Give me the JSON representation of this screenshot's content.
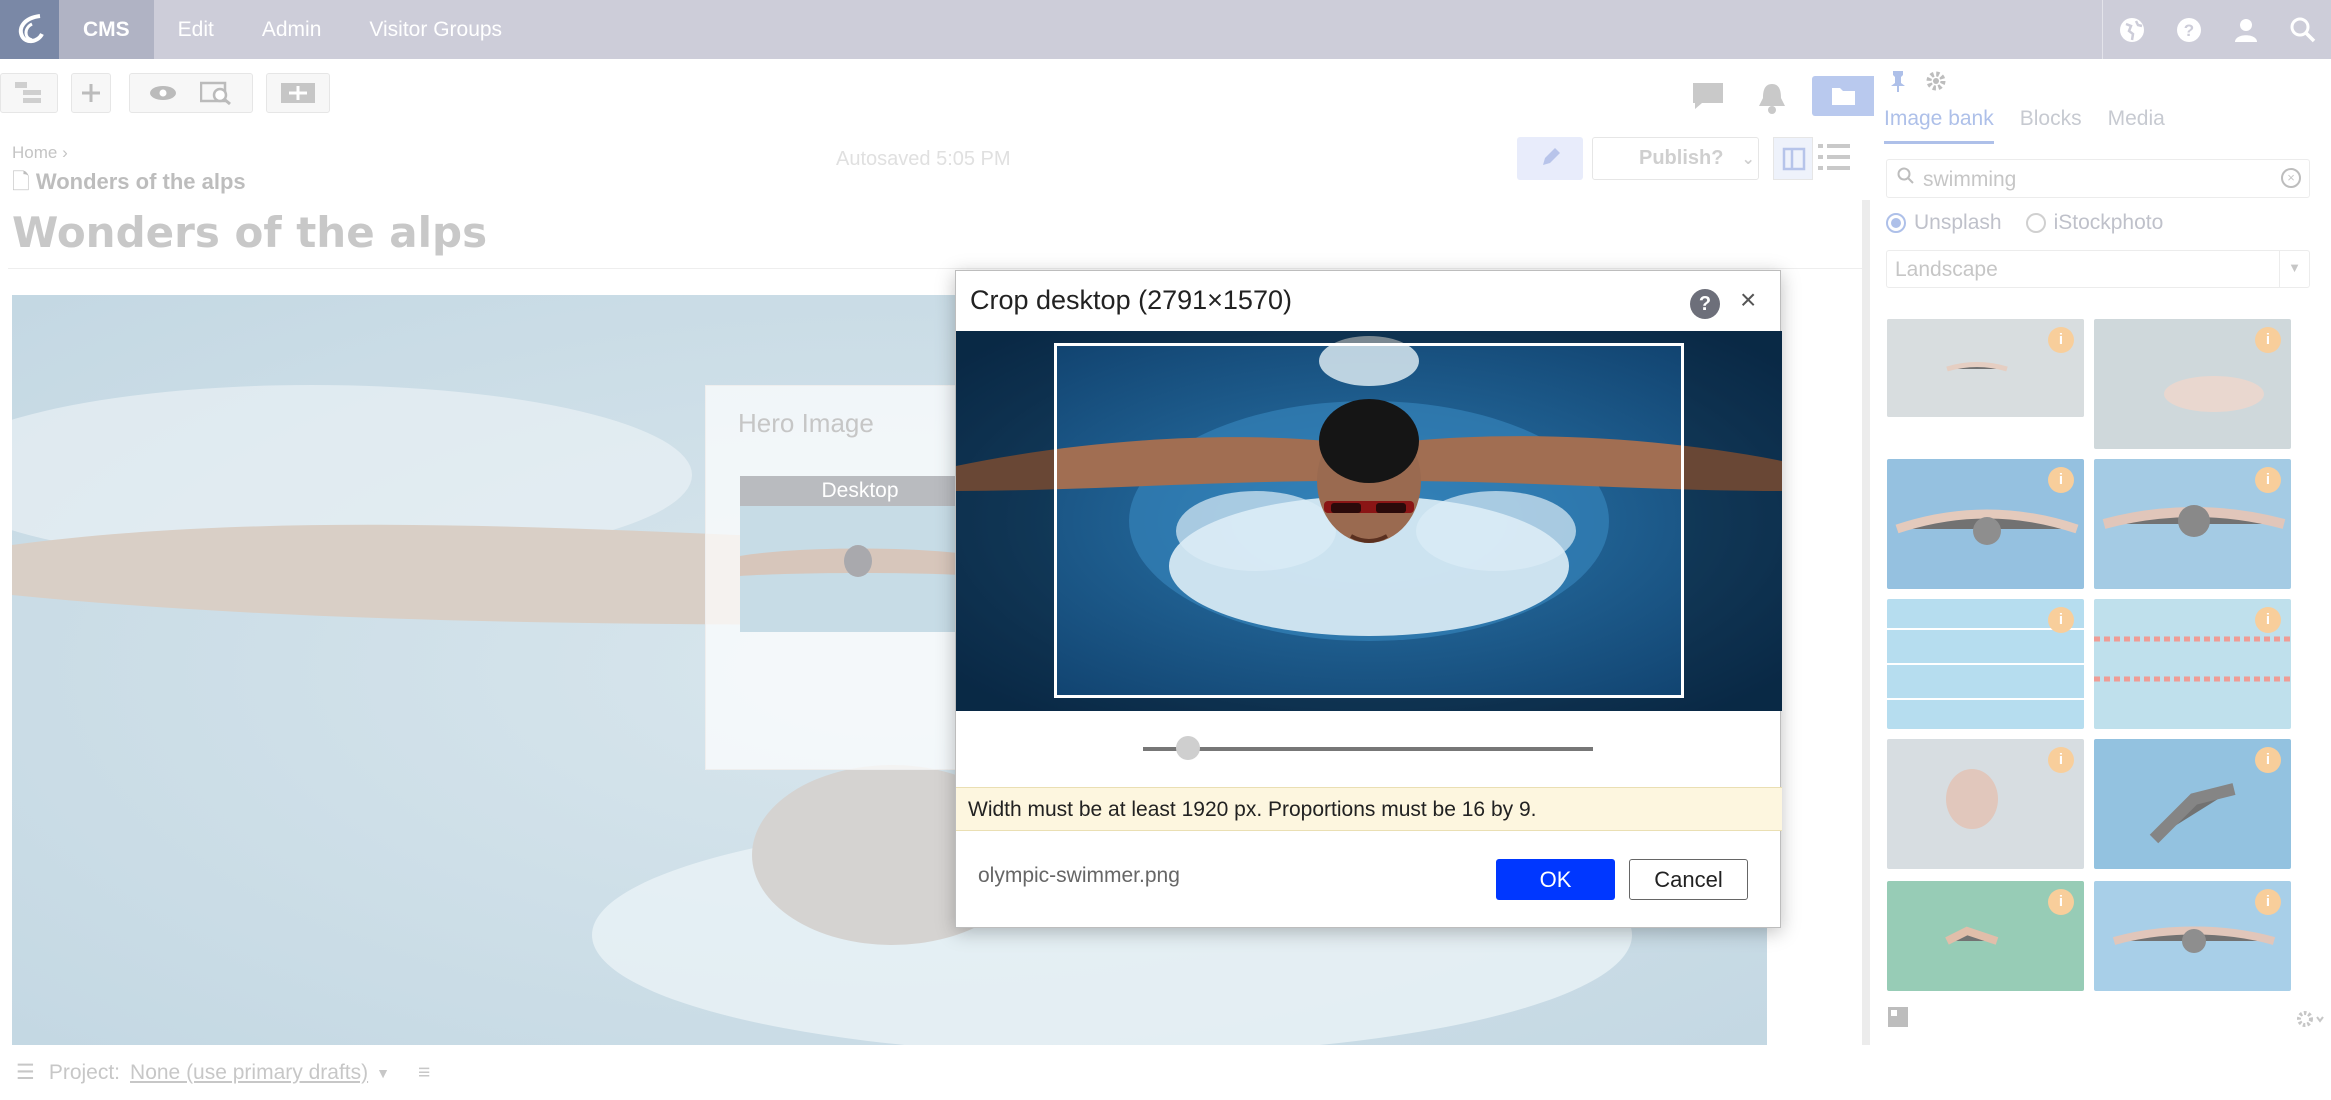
{
  "nav": {
    "items": [
      "CMS",
      "Edit",
      "Admin",
      "Visitor Groups"
    ]
  },
  "toolbar": {
    "autosaved": "Autosaved 5:05 PM",
    "publish": "Publish?"
  },
  "breadcrumb": {
    "home": "Home",
    "page": "Wonders of the alps"
  },
  "page": {
    "title": "Wonders of the alps"
  },
  "hero_panel": {
    "title": "Hero Image",
    "tab": "Desktop"
  },
  "bottom": {
    "project_label": "Project:",
    "project_value": "None (use primary drafts)"
  },
  "right_panel": {
    "tabs": [
      "Image bank",
      "Blocks",
      "Media"
    ],
    "search": "swimming",
    "sources": [
      "Unsplash",
      "iStockphoto"
    ],
    "orientation": "Landscape"
  },
  "dialog": {
    "title": "Crop desktop (2791×1570)",
    "zoom": 0.1,
    "warning": "Width must be at least 1920 px. Proportions must be 16 by 9.",
    "filename": "olympic-swimmer.png",
    "ok": "OK",
    "cancel": "Cancel"
  },
  "colors": {
    "primary": "#0037ff",
    "nav_bg": "#cdcdd9",
    "warn_bg": "#fdf6df"
  }
}
